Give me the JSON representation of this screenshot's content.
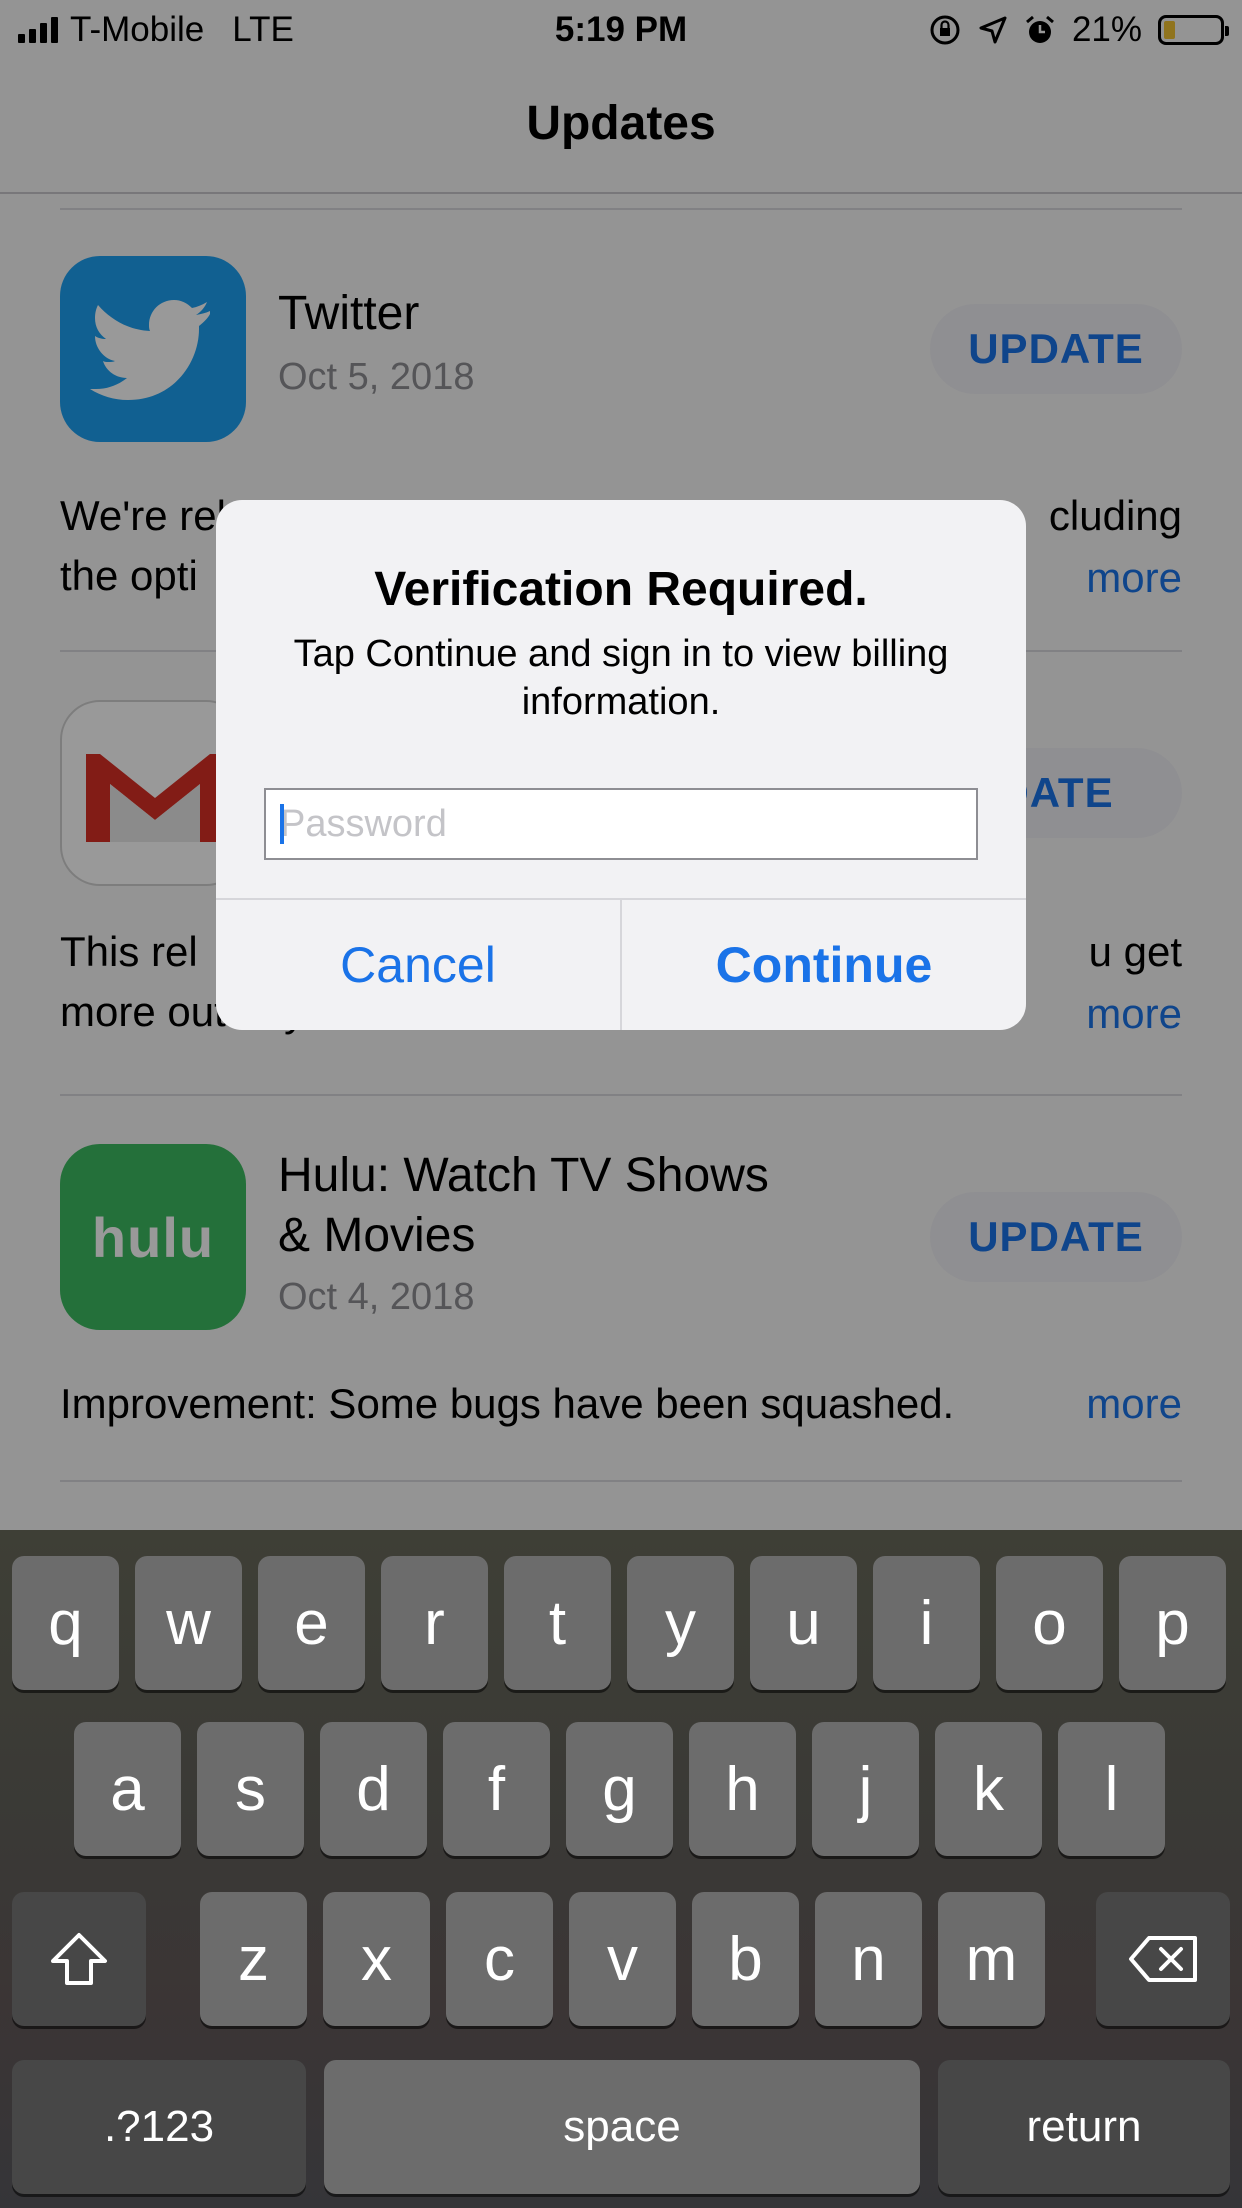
{
  "status_bar": {
    "carrier": "T-Mobile",
    "network": "LTE",
    "time": "5:19 PM",
    "battery_percent": "21%",
    "battery_level": 0.21,
    "icons": [
      "signal-icon",
      "orientation-lock-icon",
      "location-icon",
      "alarm-icon",
      "battery-icon"
    ]
  },
  "nav": {
    "title": "Updates"
  },
  "apps": [
    {
      "name": "Twitter",
      "date": "Oct 5, 2018",
      "update_label": "UPDATE",
      "desc_line1_left": "We're rel",
      "desc_line1_right": "cluding",
      "desc_line2_left": "the opti",
      "more_label": "more",
      "icon": "twitter-bird-icon",
      "icon_color": "#1da1f2"
    },
    {
      "name": "Gmail",
      "date": "",
      "update_label": "DATE",
      "desc_line1_left": "This rel",
      "desc_line1_right": "u get",
      "desc_line2_left": "more out of your inbox.",
      "more_label": "more",
      "icon": "gmail-icon",
      "icon_color": "#d93025"
    },
    {
      "name_line1": "Hulu: Watch TV Shows",
      "name_line2": "& Movies",
      "date": "Oct 4, 2018",
      "update_label": "UPDATE",
      "desc": "Improvement: Some bugs have been squashed.",
      "more_label": "more",
      "icon_text": "hulu",
      "icon_color": "#3dbb61"
    }
  ],
  "alert": {
    "title": "Verification Required.",
    "message": "Tap Continue and sign in to view billing information.",
    "password_placeholder": "Password",
    "password_value": "",
    "cancel_label": "Cancel",
    "continue_label": "Continue",
    "accent": "#1a73e8"
  },
  "keyboard": {
    "row1": [
      "q",
      "w",
      "e",
      "r",
      "t",
      "y",
      "u",
      "i",
      "o",
      "p"
    ],
    "row2": [
      "a",
      "s",
      "d",
      "f",
      "g",
      "h",
      "j",
      "k",
      "l"
    ],
    "row3": [
      "z",
      "x",
      "c",
      "v",
      "b",
      "n",
      "m"
    ],
    "shift_icon": "shift-arrow-icon",
    "delete_icon": "backspace-icon",
    "numbers_label": ".?123",
    "space_label": "space",
    "return_label": "return"
  }
}
